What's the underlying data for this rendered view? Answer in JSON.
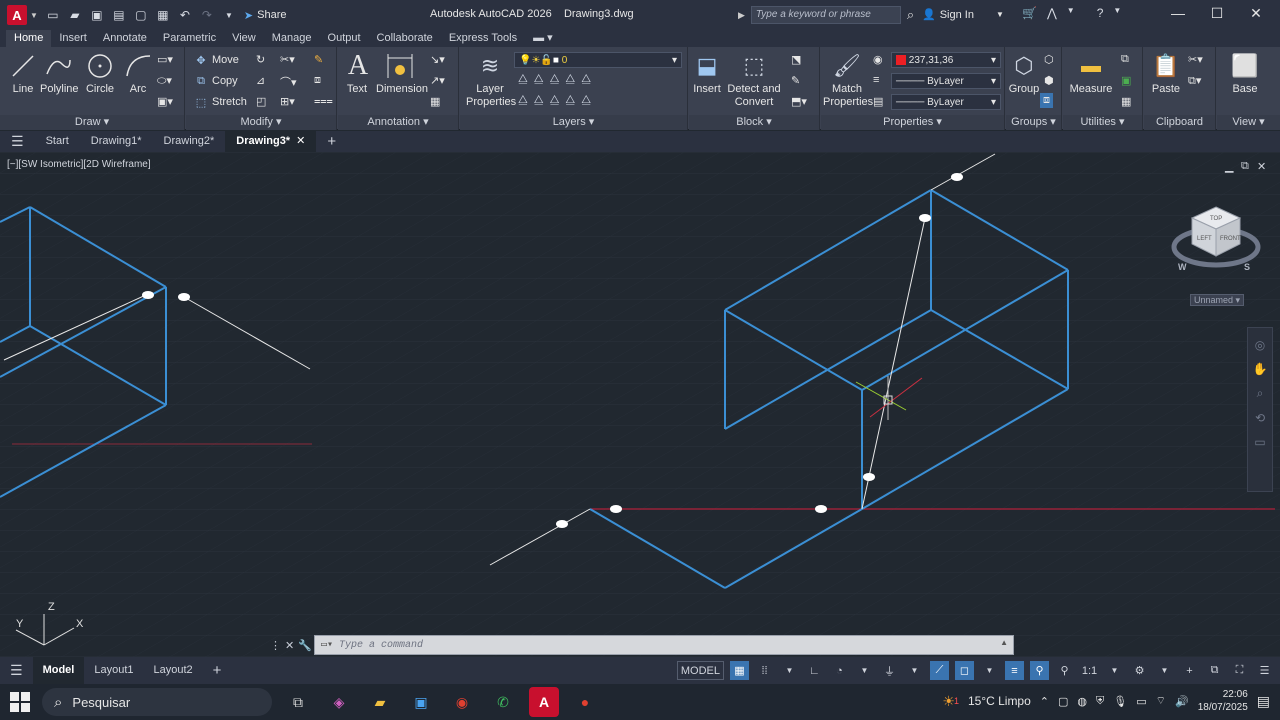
{
  "app": {
    "logo": "A",
    "title": "Autodesk AutoCAD 2026",
    "document": "Drawing3.dwg",
    "share_label": "Share",
    "search_placeholder": "Type a keyword or phrase",
    "signin_label": "Sign In"
  },
  "ribbon_tabs": [
    "Home",
    "Insert",
    "Annotate",
    "Parametric",
    "View",
    "Manage",
    "Output",
    "Collaborate",
    "Express Tools"
  ],
  "ribbon": {
    "draw": {
      "title": "Draw",
      "line": "Line",
      "polyline": "Polyline",
      "circle": "Circle",
      "arc": "Arc"
    },
    "modify": {
      "title": "Modify",
      "move": "Move",
      "copy": "Copy",
      "stretch": "Stretch"
    },
    "annotation": {
      "title": "Annotation",
      "text": "Text",
      "dimension": "Dimension"
    },
    "layers": {
      "title": "Layers",
      "layer_properties": "Layer Properties",
      "current_layer": "0"
    },
    "block": {
      "title": "Block",
      "insert": "Insert",
      "detect_convert": "Detect and Convert"
    },
    "properties": {
      "title": "Properties",
      "match_properties": "Match Properties",
      "color_value": "237,31,36",
      "linetype": "ByLayer",
      "lineweight": "ByLayer"
    },
    "groups": {
      "title": "Groups",
      "group": "Group"
    },
    "utilities": {
      "title": "Utilities",
      "measure": "Measure"
    },
    "clipboard": {
      "title": "Clipboard",
      "paste": "Paste"
    },
    "view": {
      "title": "View",
      "base": "Base"
    }
  },
  "file_tabs": {
    "start": "Start",
    "items": [
      "Drawing1*",
      "Drawing2*",
      "Drawing3*"
    ]
  },
  "viewport": {
    "label": "[−][SW Isometric][2D Wireframe]",
    "viewcube_name": "Unnamed",
    "ucs_x": "X",
    "ucs_y": "Y",
    "ucs_z": "Z",
    "viewcube_faces": {
      "top": "TOP",
      "left": "LEFT",
      "front": "FRONT",
      "w": "W",
      "s": "S"
    }
  },
  "command": {
    "placeholder": "Type a command"
  },
  "layout_tabs": [
    "Model",
    "Layout1",
    "Layout2"
  ],
  "status": {
    "model": "MODEL",
    "scale": "1:1"
  },
  "taskbar": {
    "search": "Pesquisar",
    "weather": "15°C  Limpo",
    "time": "22:06",
    "date": "18/07/2025",
    "weather_badge": "1"
  },
  "colors": {
    "accent": "#3a74b0",
    "drawing_lines": "#3b8fd4",
    "selected_red": "#c8102e"
  }
}
